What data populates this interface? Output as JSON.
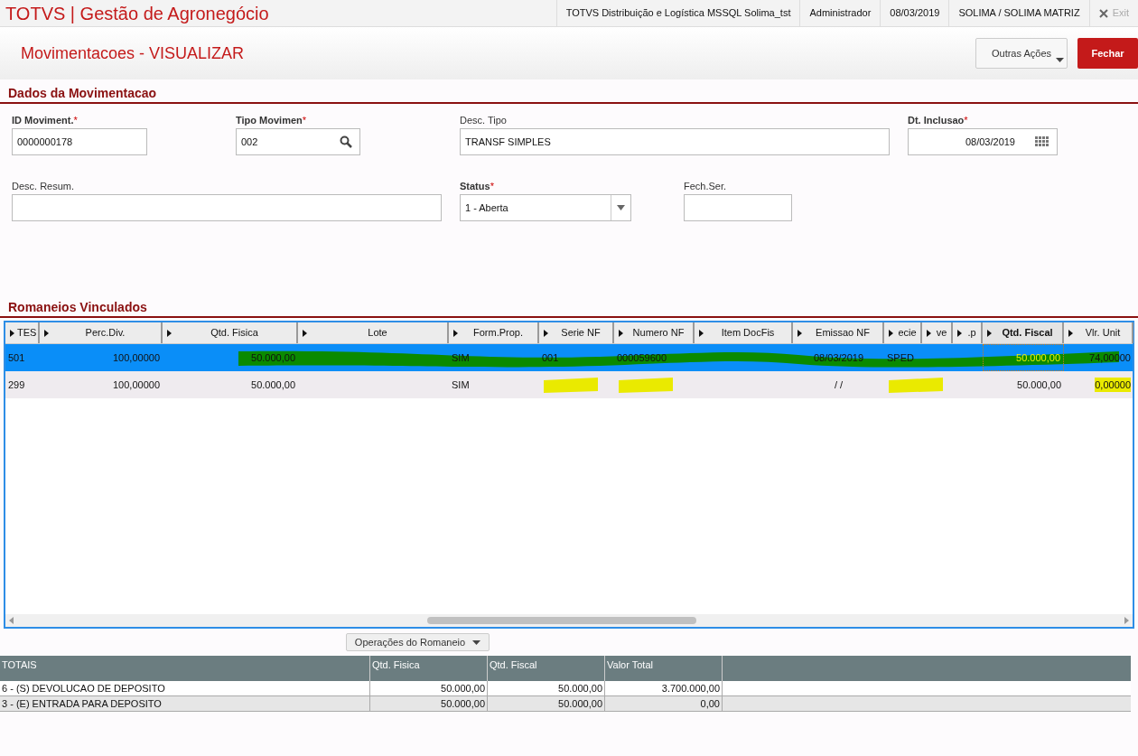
{
  "app": {
    "title": "TOTVS | Gestão de Agronegócio",
    "header_items": [
      "TOTVS Distribuição e Logística MSSQL Solima_tst",
      "Administrador",
      "08/03/2019",
      "SOLIMA / SOLIMA MATRIZ"
    ],
    "exit": "Exit"
  },
  "page": {
    "title": "Movimentacoes - VISUALIZAR",
    "actions": [
      {
        "label": "Outras Ações",
        "kind": "menu"
      },
      {
        "label": "Fechar",
        "kind": "primary"
      }
    ]
  },
  "section_1": {
    "title": "Dados da Movimentacao",
    "fields": [
      {
        "label": "ID Moviment.",
        "required_mark": "*",
        "value": "0000000178",
        "kind": "text"
      },
      {
        "label": "Tipo Movimen",
        "required_mark": "*",
        "value": "002",
        "kind": "search"
      },
      {
        "label": "Desc. Tipo",
        "value": "TRANSF SIMPLES",
        "kind": "text"
      },
      {
        "label": "Dt. Inclusao",
        "required_mark": "*",
        "value": "08/03/2019",
        "kind": "date"
      },
      {
        "label": "Desc. Resum.",
        "kind": "text"
      },
      {
        "label": "Status",
        "required_mark": "*",
        "value": "1 - Aberta",
        "kind": "select"
      },
      {
        "label": "Fech.Ser.",
        "kind": "text"
      }
    ]
  },
  "section_2": {
    "title": "Romaneios Vinculados",
    "columns": [
      {
        "label": "TES",
        "selected": false
      },
      {
        "label": "Perc.Div.",
        "selected": false
      },
      {
        "label": "Qtd. Fisica",
        "selected": false
      },
      {
        "label": "Lote",
        "selected": false
      },
      {
        "label": "Form.Prop.",
        "selected": false
      },
      {
        "label": "Serie NF",
        "selected": false
      },
      {
        "label": "Numero NF",
        "selected": false
      },
      {
        "label": "Item DocFis",
        "selected": false
      },
      {
        "label": "Emissao NF",
        "selected": false
      },
      {
        "label": "ecie",
        "selected": false
      },
      {
        "label": "ve",
        "selected": false
      },
      {
        "label": ".p",
        "selected": false
      },
      {
        "label": "Qtd. Fiscal",
        "selected": true
      },
      {
        "label": "Vlr. Unit",
        "selected": false
      }
    ],
    "rows": [
      {
        "selected": true,
        "cells": [
          "501",
          "100,00000",
          "50.000,00",
          null,
          "SIM",
          "001",
          "000059600",
          null,
          "08/03/2019",
          "SPED",
          null,
          null,
          "50.000,00",
          "74,00000"
        ]
      },
      {
        "selected": false,
        "cells": [
          "299",
          "100,00000",
          "50.000,00",
          null,
          "SIM",
          null,
          null,
          null,
          "/ /",
          null,
          null,
          null,
          "50.000,00",
          "0,00000"
        ]
      }
    ],
    "operations_button": "Operações do Romaneio"
  },
  "totals": {
    "columns": [
      "TOTAIS",
      "Qtd. Fisica",
      "Qtd. Fiscal",
      "Valor Total"
    ],
    "rows": [
      [
        "6 - (S) DEVOLUCAO DE DEPOSITO",
        "50.000,00",
        "50.000,00",
        "3.700.000,00"
      ],
      [
        "3 - (E) ENTRADA PARA DEPOSITO",
        "50.000,00",
        "50.000,00",
        "0,00"
      ]
    ]
  }
}
